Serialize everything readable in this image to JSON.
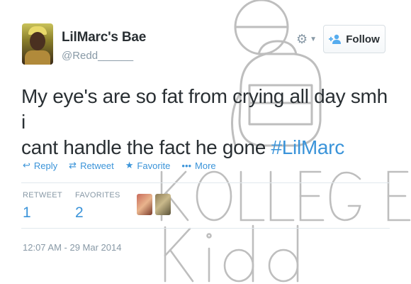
{
  "user": {
    "display_name": "LilMarc's Bae",
    "screen_name": "@Redd______"
  },
  "header": {
    "follow_label": "Follow",
    "gear_icon": "gear-icon",
    "person_add_icon": "person-add-icon"
  },
  "tweet": {
    "text_line1": "My eye's are so fat from crying all day smh i",
    "text_line2_before_hashtag": "cant handle the fact he gone ",
    "hashtag": "#LilMarc"
  },
  "actions": [
    {
      "label": "Reply",
      "icon": "reply-icon"
    },
    {
      "label": "Retweet",
      "icon": "retweet-icon"
    },
    {
      "label": "Favorite",
      "icon": "star-icon"
    },
    {
      "label": "More",
      "icon": "more-dots-icon"
    }
  ],
  "stats": {
    "retweet_label": "RETWEET",
    "retweet_count": "1",
    "favorites_label": "FAVORITES",
    "favorites_count": "2"
  },
  "timestamp": "12:07 AM - 29 Mar 2014",
  "watermark": {
    "line1": "KOLLEGE",
    "line2": "Kidd"
  },
  "colors": {
    "link": "#3b94d9",
    "muted": "#8899a6",
    "text": "#292f33",
    "watermark": "#b4b4b4"
  }
}
